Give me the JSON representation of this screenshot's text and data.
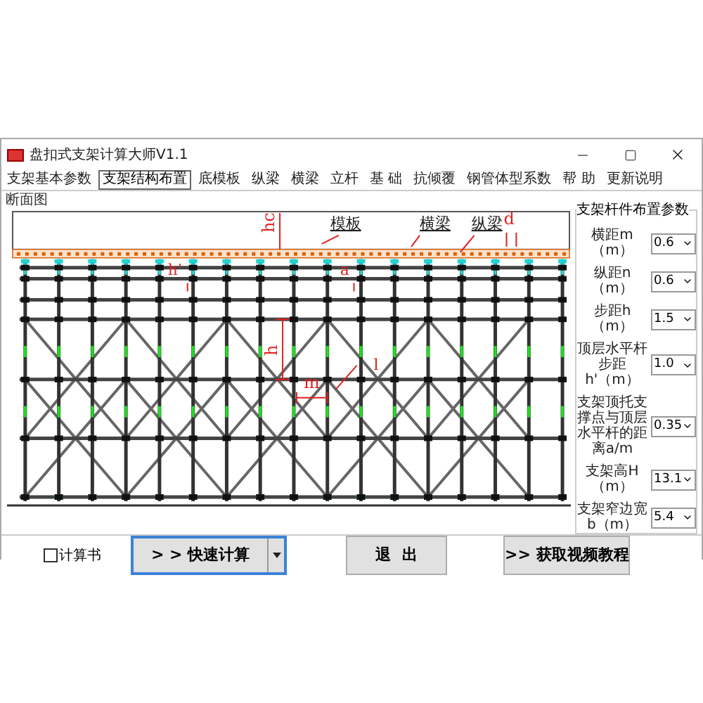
{
  "window": {
    "title": "盘扣式支架计算大师V1.1"
  },
  "tabs": [
    {
      "label": "支架基本参数",
      "selected": false
    },
    {
      "label": "支架结构布置",
      "selected": true
    },
    {
      "label": "底模板",
      "selected": false
    },
    {
      "label": "纵梁",
      "selected": false
    },
    {
      "label": "横梁",
      "selected": false
    },
    {
      "label": "立杆",
      "selected": false
    },
    {
      "label": "基 础",
      "selected": false
    },
    {
      "label": "抗倾覆",
      "selected": false
    },
    {
      "label": "钢管体型系数",
      "selected": false
    },
    {
      "label": "帮 助",
      "selected": false
    },
    {
      "label": "更新说明",
      "selected": false
    }
  ],
  "section": {
    "title": "断面图",
    "labels": [
      "hc",
      "模板",
      "横梁",
      "纵梁",
      "d",
      "h'",
      "a",
      "h",
      "m",
      "l"
    ]
  },
  "params": {
    "title": "支架杆件布置参数",
    "rows": [
      {
        "label": "横距m（m）",
        "value": "0.6"
      },
      {
        "label": "纵距n（m）",
        "value": "0.6"
      },
      {
        "label": "步距h（m）",
        "value": "1.5"
      },
      {
        "label": "顶层水平杆步距h'（m）",
        "value": "1.0"
      },
      {
        "label": "支架顶托支撑点与顶层水平杆的距离a/m",
        "value": "0.35"
      },
      {
        "label": "支架高H（m）",
        "value": "13.1"
      },
      {
        "label": "支架窄边宽b（m）",
        "value": "5.4"
      }
    ]
  },
  "footer": {
    "checkbox": {
      "label": "计算书",
      "checked": false
    },
    "buttons": [
      {
        "label": "> > 快速计算",
        "kind": "split"
      },
      {
        "label": "退  出",
        "kind": "plain"
      },
      {
        "label": ">> 获取视频教程",
        "kind": "plain"
      }
    ]
  }
}
